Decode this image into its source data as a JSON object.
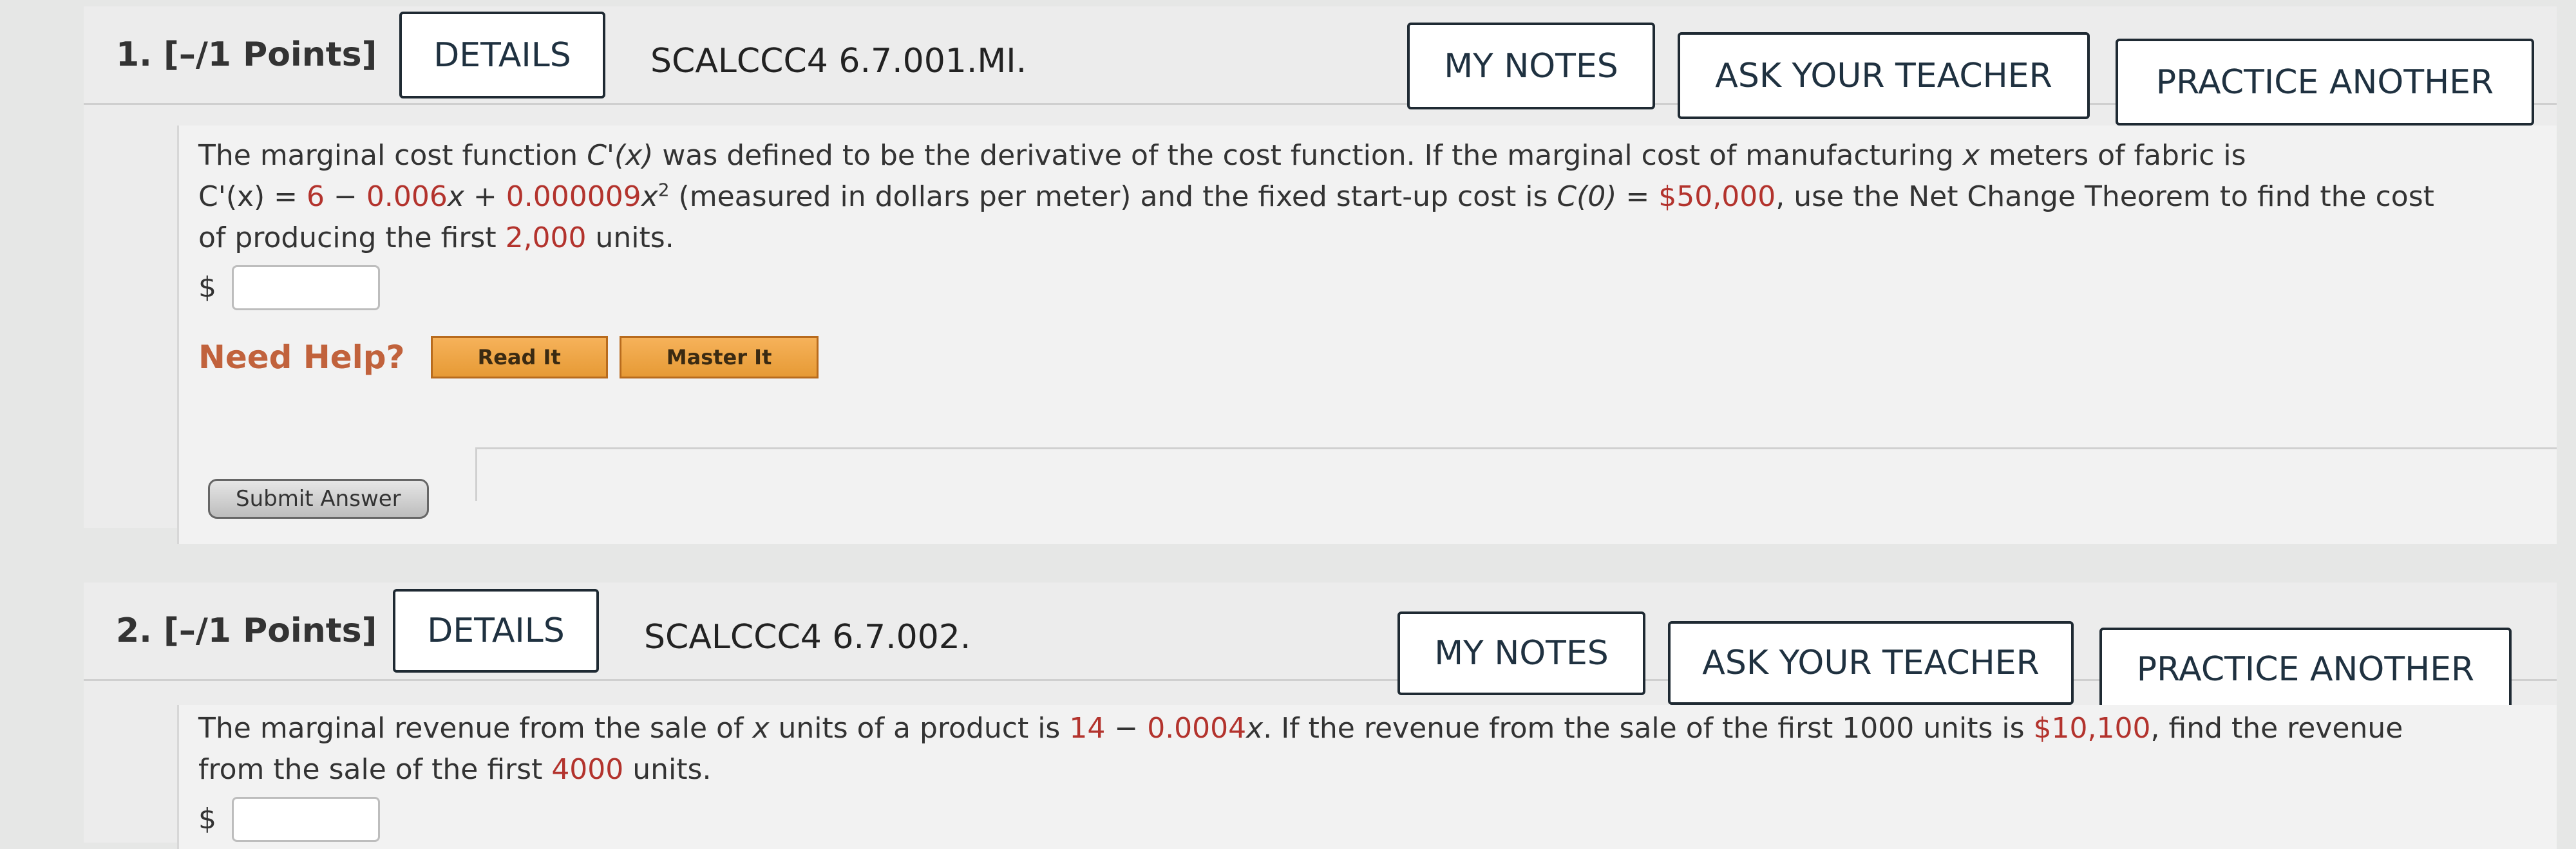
{
  "q1": {
    "number": "1.",
    "points": "[–/1 Points]",
    "details_label": "DETAILS",
    "code": "SCALCCC4 6.7.001.MI.",
    "my_notes_label": "MY NOTES",
    "ask_teacher_label": "ASK YOUR TEACHER",
    "practice_label": "PRACTICE ANOTHER",
    "text_1": "The marginal cost function ",
    "func_name": "C'(x)",
    "text_2": " was defined to be the derivative of the cost function. If the marginal cost of manufacturing ",
    "var_x": "x",
    "text_3": " meters of fabric is",
    "eq_lhs": "C'(x) = ",
    "eq_c1": "6",
    "eq_minus": " − ",
    "eq_c2": "0.006",
    "eq_x": "x",
    "eq_plus": " + ",
    "eq_c3": "0.000009",
    "eq_x2": "x",
    "eq_exp": "2",
    "text_4": " (measured in dollars per meter) and the fixed start-up cost is ",
    "c0": "C(0) = ",
    "c0_value": "$50,000",
    "text_5": ", use the Net Change Theorem to find the cost",
    "text_6": "of producing the first ",
    "units": "2,000",
    "text_7": " units.",
    "dollar": "$",
    "answer_value": "",
    "need_help": "Need Help?",
    "read_it": "Read It",
    "master_it": "Master It",
    "submit": "Submit Answer"
  },
  "q2": {
    "number": "2.",
    "points": "[–/1 Points]",
    "details_label": "DETAILS",
    "code": "SCALCCC4 6.7.002.",
    "my_notes_label": "MY NOTES",
    "ask_teacher_label": "ASK YOUR TEACHER",
    "practice_label": "PRACTICE ANOTHER",
    "text_1": "The marginal revenue from the sale of ",
    "var_x": "x",
    "text_2": " units of a product is ",
    "r1": "14",
    "r_minus": " − ",
    "r2": "0.0004",
    "r_x": "x",
    "text_3": ". If the revenue from the sale of the first 1000 units is ",
    "rev": "$10,100",
    "text_4": ", find the revenue",
    "text_5": "from the sale of the first ",
    "units": "4000",
    "text_6": " units.",
    "dollar": "$",
    "answer_value": ""
  },
  "colors": {
    "accent_red": "#b3332d",
    "need_help_orange": "#c1623c",
    "help_button": "#e69a35"
  }
}
